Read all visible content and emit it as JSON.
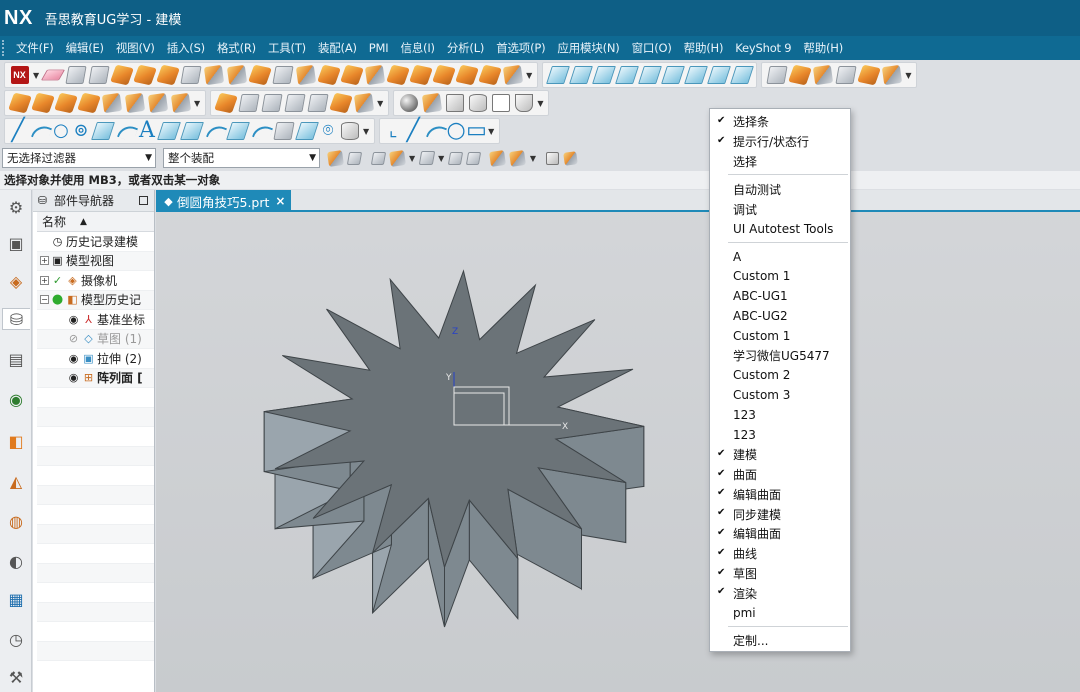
{
  "app": {
    "logo": "NX",
    "title": "吾思教育UG学习 - 建模"
  },
  "menubar": [
    "文件(F)",
    "编辑(E)",
    "视图(V)",
    "插入(S)",
    "格式(R)",
    "工具(T)",
    "装配(A)",
    "PMI",
    "信息(I)",
    "分析(L)",
    "首选项(P)",
    "应用模块(N)",
    "窗口(O)",
    "帮助(H)",
    "KeyShot 9",
    "帮助(H)"
  ],
  "toolbar": {
    "text_glyph": "A"
  },
  "filter": {
    "type_filter": "无选择过滤器",
    "scope": "整个装配"
  },
  "status_hint": "选择对象并使用 MB3，或者双击某一对象",
  "navigator": {
    "title": "部件导航器",
    "column": "名称",
    "items": [
      {
        "label": "历史记录建模",
        "expander": "",
        "icon": "clock-icon"
      },
      {
        "label": "模型视图",
        "expander": "+",
        "icon": "model-views-icon"
      },
      {
        "label": "摄像机",
        "expander": "+",
        "icon": "camera-icon"
      },
      {
        "label": "模型历史记",
        "expander": "−",
        "icon": "model-history-icon"
      },
      {
        "label": "基准坐标",
        "icon": "datum-csys-icon"
      },
      {
        "label": "草图 (1)",
        "icon": "sketch-icon"
      },
      {
        "label": "拉伸 (2)",
        "icon": "extrude-icon"
      },
      {
        "label": "阵列面 [",
        "icon": "pattern-face-icon"
      }
    ]
  },
  "document_tab": {
    "label": "倒圆角技巧5.prt",
    "close": "×"
  },
  "axis": {
    "x": "X",
    "y": "Y",
    "z": "Z"
  },
  "context_menu": {
    "groups": [
      [
        {
          "label": "选择条",
          "checked": true
        },
        {
          "label": "提示行/状态行",
          "checked": true
        },
        {
          "label": "选择",
          "checked": false
        }
      ],
      [
        {
          "label": "自动测试",
          "checked": false
        },
        {
          "label": "调试",
          "checked": false
        },
        {
          "label": "UI Autotest Tools",
          "checked": false
        }
      ],
      [
        {
          "label": "A",
          "checked": false
        },
        {
          "label": "Custom 1",
          "checked": false
        },
        {
          "label": "ABC-UG1",
          "checked": false
        },
        {
          "label": "ABC-UG2",
          "checked": false
        },
        {
          "label": "Custom 1",
          "checked": false
        },
        {
          "label": "学习微信UG5477",
          "checked": false
        },
        {
          "label": "Custom 2",
          "checked": false
        },
        {
          "label": "Custom 3",
          "checked": false
        },
        {
          "label": "123",
          "checked": false
        },
        {
          "label": "123",
          "checked": false
        },
        {
          "label": "建模",
          "checked": true
        },
        {
          "label": "曲面",
          "checked": true
        },
        {
          "label": "编辑曲面",
          "checked": true
        },
        {
          "label": "同步建模",
          "checked": true
        },
        {
          "label": "编辑曲面",
          "checked": true
        },
        {
          "label": "曲线",
          "checked": true
        },
        {
          "label": "草图",
          "checked": true
        },
        {
          "label": "渲染",
          "checked": true
        },
        {
          "label": "pmi",
          "checked": false
        }
      ],
      [
        {
          "label": "定制...",
          "checked": false
        }
      ]
    ],
    "check_glyph": "✔"
  },
  "colors": {
    "title_bar": "#0e5f86",
    "menu_bar": "#0f6a93",
    "accent": "#1f8ab8",
    "model_face": "#6b7378",
    "model_side": "#8f9aa2"
  }
}
